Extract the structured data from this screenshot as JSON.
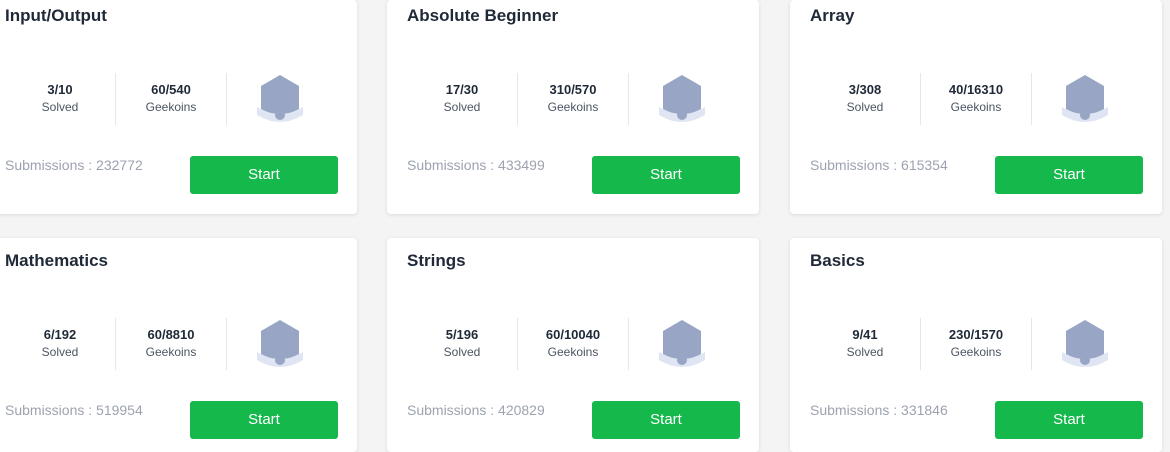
{
  "cards": [
    {
      "title": "Input/Output",
      "solved": "3/10",
      "solved_label": "Solved",
      "geekoins": "60/540",
      "geekoins_label": "Geekoins",
      "submissions": "Submissions : 232772",
      "button": "Start"
    },
    {
      "title": "Absolute Beginner",
      "solved": "17/30",
      "solved_label": "Solved",
      "geekoins": "310/570",
      "geekoins_label": "Geekoins",
      "submissions": "Submissions : 433499",
      "button": "Start"
    },
    {
      "title": "Array",
      "solved": "3/308",
      "solved_label": "Solved",
      "geekoins": "40/16310",
      "geekoins_label": "Geekoins",
      "submissions": "Submissions : 615354",
      "button": "Start"
    },
    {
      "title": "Mathematics",
      "solved": "6/192",
      "solved_label": "Solved",
      "geekoins": "60/8810",
      "geekoins_label": "Geekoins",
      "submissions": "Submissions : 519954",
      "button": "Start"
    },
    {
      "title": "Strings",
      "solved": "5/196",
      "solved_label": "Solved",
      "geekoins": "60/10040",
      "geekoins_label": "Geekoins",
      "submissions": "Submissions : 420829",
      "button": "Start"
    },
    {
      "title": "Basics",
      "solved": "9/41",
      "solved_label": "Solved",
      "geekoins": "230/1570",
      "geekoins_label": "Geekoins",
      "submissions": "Submissions : 331846",
      "button": "Start"
    }
  ],
  "colors": {
    "start_button": "#14b84b",
    "badge": "#98a5c4",
    "badge_ribbon": "#dfe5f3"
  },
  "icons": {
    "badge": "medal-badge-icon"
  }
}
